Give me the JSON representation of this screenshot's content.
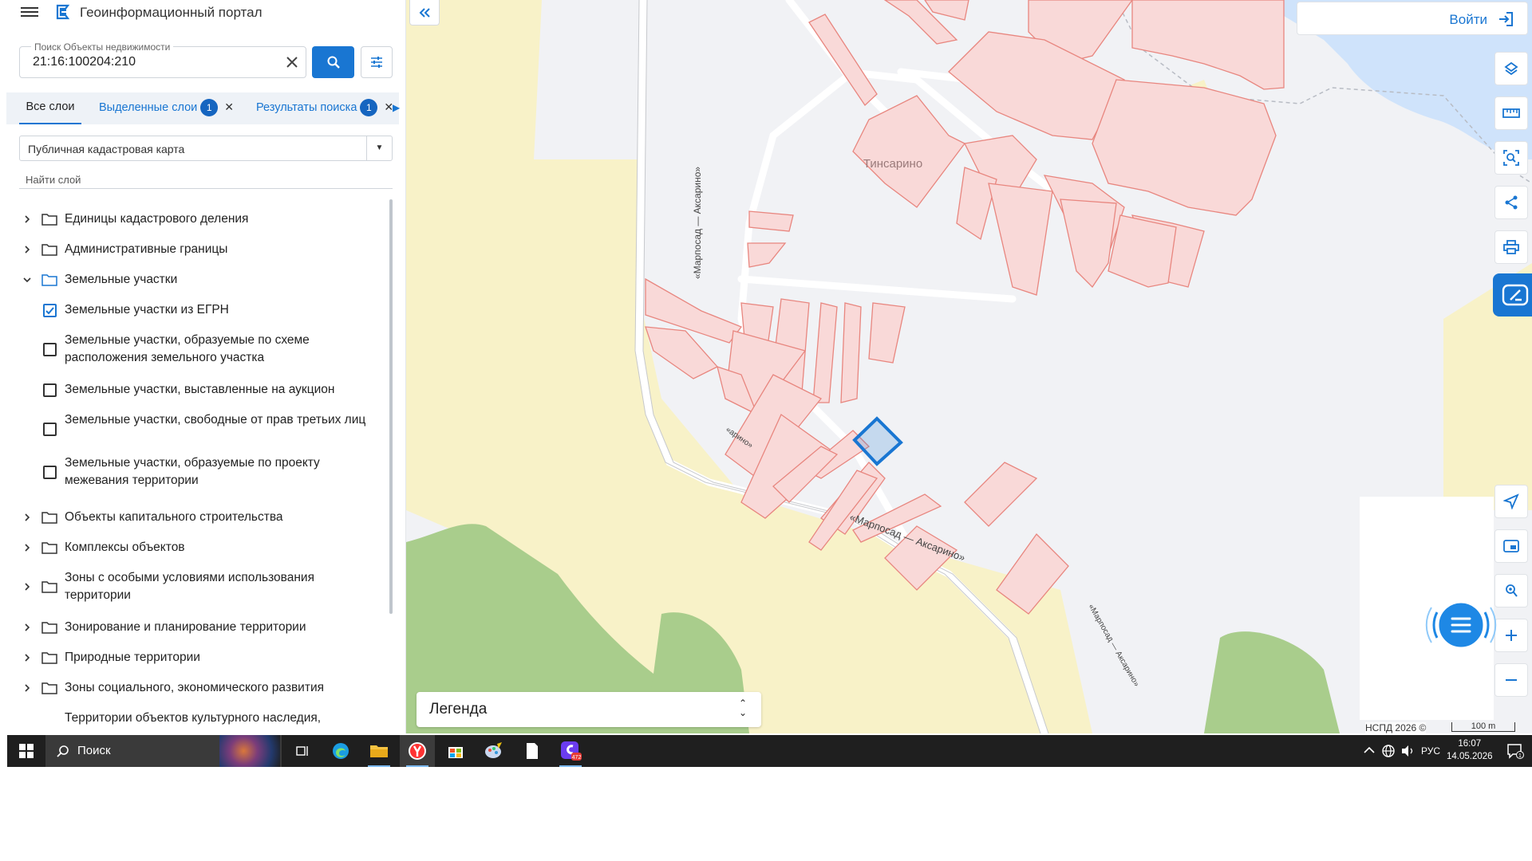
{
  "app": {
    "title": "Геоинформационный портал"
  },
  "search": {
    "label": "Поиск Объекты недвижимости",
    "value": "21:16:100204:210"
  },
  "tabs": [
    {
      "label": "Все слои"
    },
    {
      "label": "Выделенные слои",
      "badge": "1"
    },
    {
      "label": "Результаты поиска",
      "badge": "1"
    }
  ],
  "basemap": {
    "selected": "Публичная кадастровая карта"
  },
  "layer_search": {
    "placeholder": "Найти слой"
  },
  "layers": [
    {
      "label": "Единицы кадастрового деления",
      "type": "folder",
      "expanded": false
    },
    {
      "label": "Административные границы",
      "type": "folder",
      "expanded": false
    },
    {
      "label": "Земельные участки",
      "type": "folder",
      "expanded": true
    },
    {
      "label": "Земельные участки из ЕГРН",
      "type": "checkbox",
      "checked": true
    },
    {
      "label": "Земельные участки, образуемые по схеме расположения земельного участка",
      "type": "checkbox",
      "checked": false
    },
    {
      "label": "Земельные участки, выставленные на аукцион",
      "type": "checkbox",
      "checked": false
    },
    {
      "label": "Земельные участки, свободные от прав третьих лиц",
      "type": "checkbox",
      "checked": false
    },
    {
      "label": "Земельные участки, образуемые по проекту межевания территории",
      "type": "checkbox",
      "checked": false
    },
    {
      "label": "Объекты капитального строительства",
      "type": "folder",
      "expanded": false
    },
    {
      "label": "Комплексы объектов",
      "type": "folder",
      "expanded": false
    },
    {
      "label": "Зоны с особыми условиями использования территории",
      "type": "folder",
      "expanded": false
    },
    {
      "label": "Зонирование и планирование территории",
      "type": "folder",
      "expanded": false
    },
    {
      "label": "Природные территории",
      "type": "folder",
      "expanded": false
    },
    {
      "label": "Зоны социального, экономического развития",
      "type": "folder",
      "expanded": false
    },
    {
      "label": "Территории объектов культурного наследия,",
      "type": "text"
    }
  ],
  "map": {
    "login_label": "Войти",
    "legend_label": "Легенда",
    "attribution": "НСПД 2026 ©",
    "scale_label": "100 m",
    "place_label": "Тинсарино",
    "road_labels": [
      "«Марпосад — Аксарино»",
      "«Марпосад — Аксарино»",
      "«Марпосад — Аксарино»",
      "«арино»"
    ],
    "colors": {
      "parcel_fill": "#f9d9d8",
      "parcel_stroke": "#e8867f",
      "selected_stroke": "#1976d2",
      "field": "#f8f2c8",
      "forest": "#a9cd8c",
      "water": "#cfe3fb",
      "background": "#f1f2f5"
    }
  },
  "taskbar": {
    "search_label": "Поиск",
    "language": "РУС",
    "time": "16:07",
    "date": "14.05.2026",
    "notification_count": "1",
    "app_badge": "472"
  }
}
